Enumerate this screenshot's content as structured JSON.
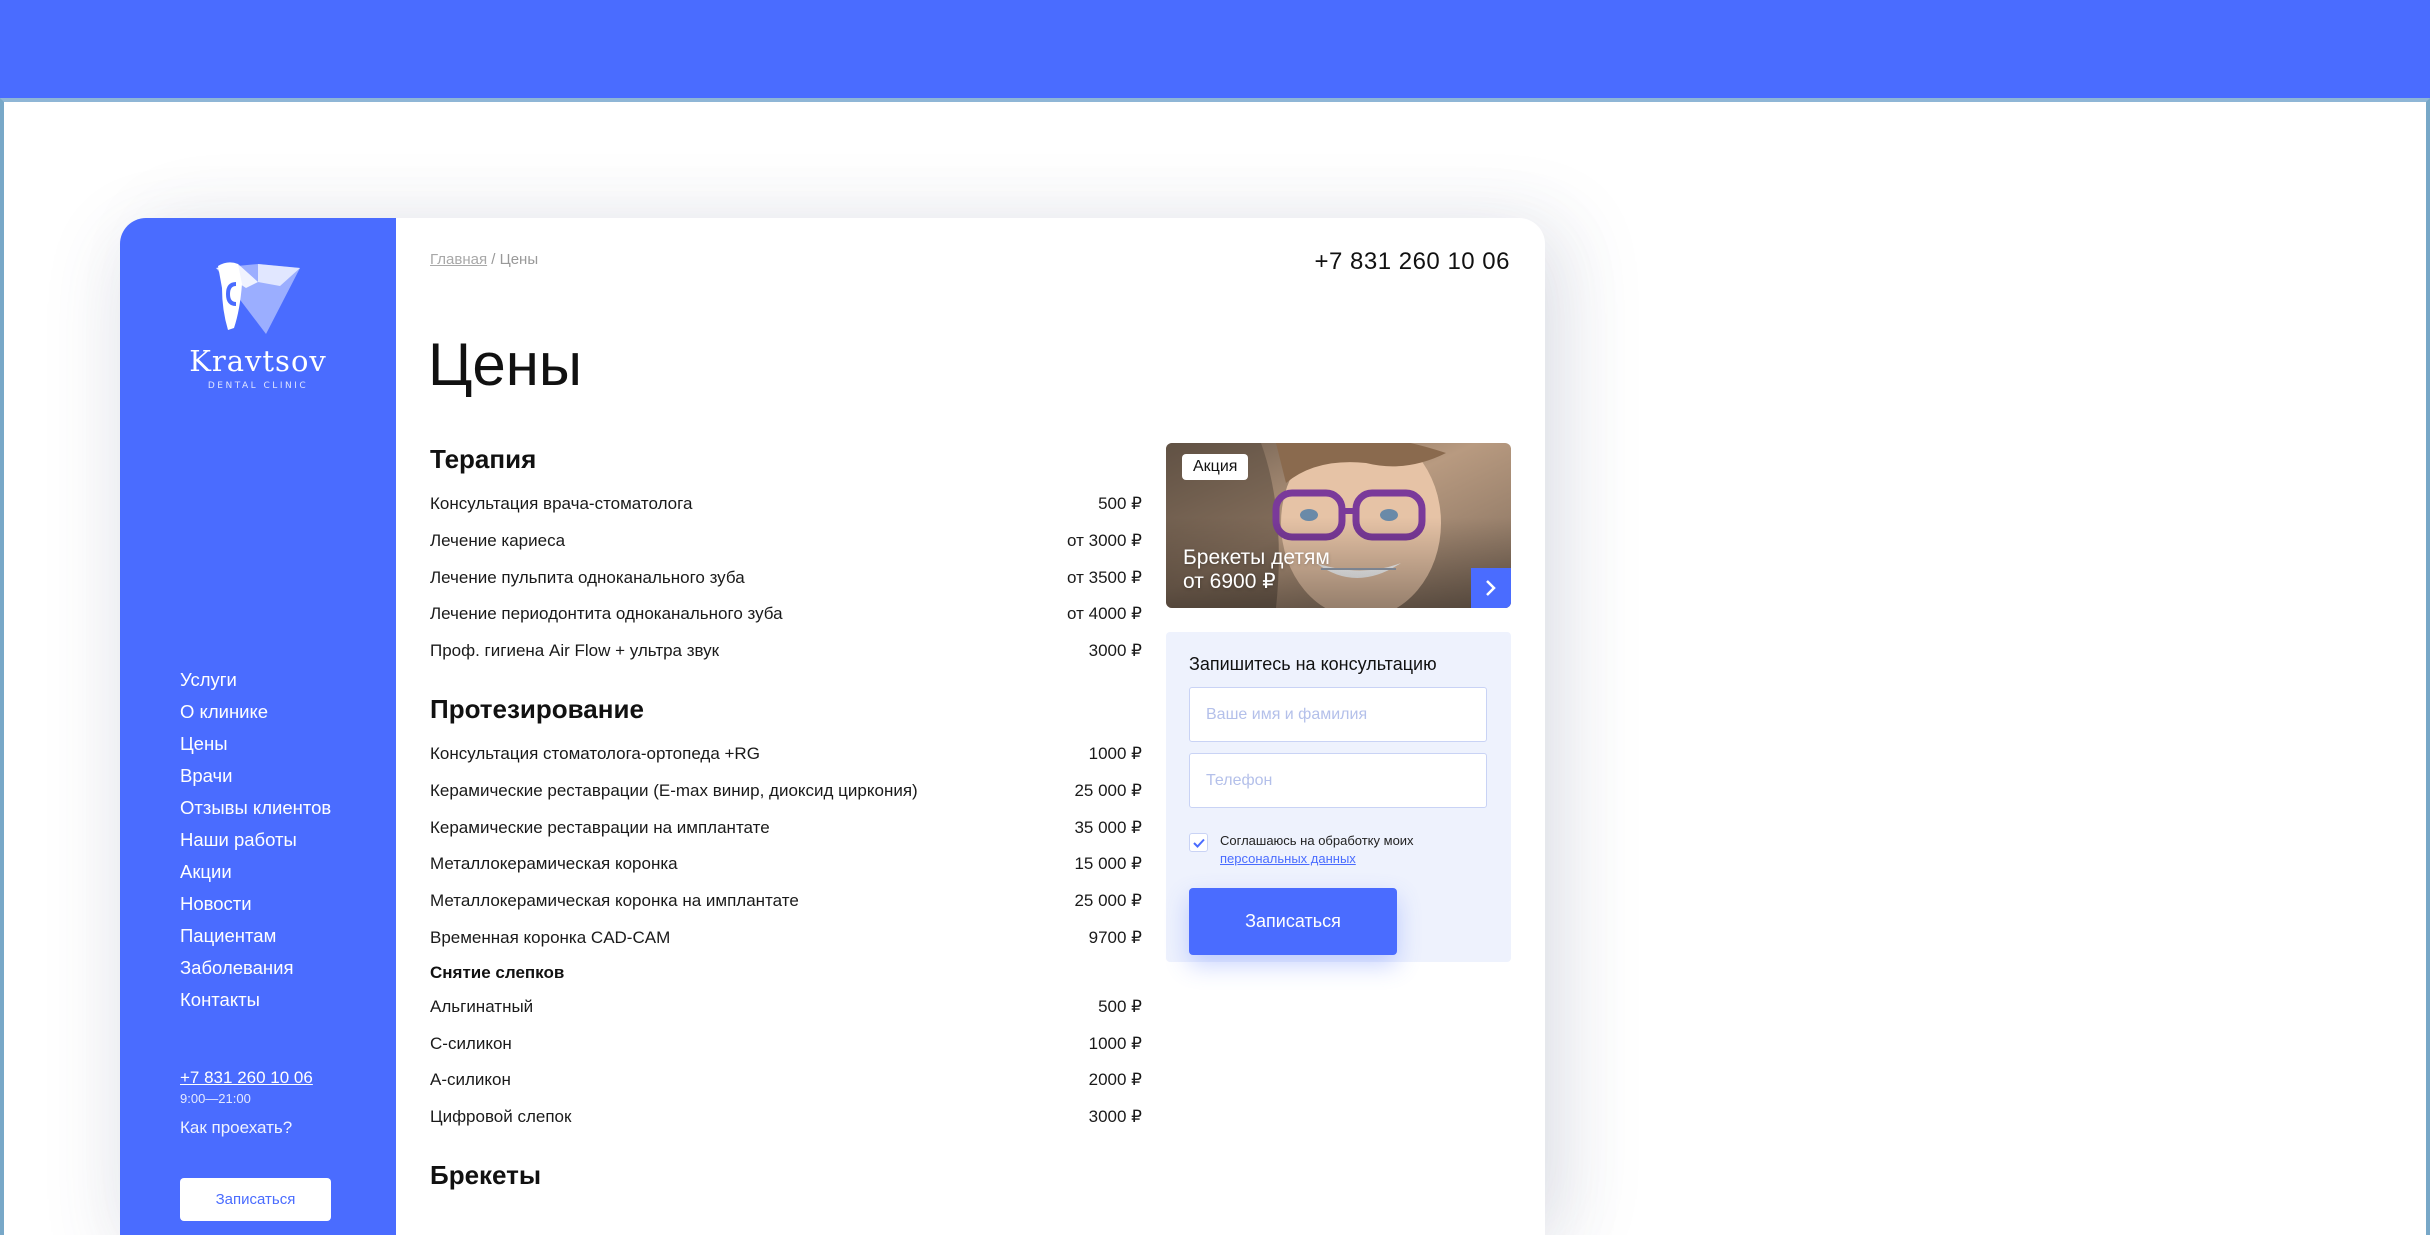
{
  "brand": {
    "name": "Kravtsov",
    "tagline": "DENTAL CLINIC",
    "accent_color": "#4a6cff"
  },
  "sidebar": {
    "nav": [
      "Услуги",
      "О клинике",
      "Цены",
      "Врачи",
      "Отзывы клиентов",
      "Наши работы",
      "Акции",
      "Новости",
      "Пациентам",
      "Заболевания",
      "Контакты"
    ],
    "phone": "+7 831 260 10 06",
    "hours": "9:00—21:00",
    "route": "Как проехать?",
    "button": "Записаться",
    "socials": [
      "vk-icon",
      "instagram-icon"
    ]
  },
  "header": {
    "breadcrumb_home": "Главная",
    "breadcrumb_sep": " / ",
    "breadcrumb_current": "Цены",
    "phone": "+7 831 260 10 06"
  },
  "page": {
    "title": "Цены"
  },
  "sections": [
    {
      "title": "Терапия",
      "rows": [
        [
          "Консультация врача-стоматолога",
          "500 ₽"
        ],
        [
          "Лечение кариеса",
          "от 3000 ₽"
        ],
        [
          "Лечение пульпита одноканального зуба",
          "от 3500 ₽"
        ],
        [
          "Лечение периодонтита одноканального зуба",
          "от 4000 ₽"
        ],
        [
          "Проф. гигиена Air Flow + ультра звук",
          "3000 ₽"
        ]
      ]
    },
    {
      "title": "Протезирование",
      "rows": [
        [
          "Консультация стоматолога-ортопеда +RG",
          "1000 ₽"
        ],
        [
          "Керамические реставрации (E-max винир, диоксид циркония)",
          "25 000 ₽"
        ],
        [
          "Керамические реставрации на имплантате",
          "35 000 ₽"
        ],
        [
          "Металлокерамическая коронка",
          "15 000 ₽"
        ],
        [
          "Металлокерамическая коронка на имплантате",
          "25 000 ₽"
        ],
        [
          "Временная коронка CAD-CAM",
          "9700 ₽"
        ]
      ],
      "subsection": {
        "title": "Снятие слепков",
        "rows": [
          [
            "Альгинатный",
            "500 ₽"
          ],
          [
            "С-силикон",
            "1000 ₽"
          ],
          [
            "А-силикон",
            "2000 ₽"
          ],
          [
            "Цифровой слепок",
            "3000 ₽"
          ]
        ]
      }
    },
    {
      "title": "Брекеты",
      "rows": []
    }
  ],
  "promo": {
    "badge": "Акция",
    "line1": "Брекеты детям",
    "line2": "от 6900 ₽"
  },
  "form": {
    "title": "Запишитесь на консультацию",
    "name_placeholder": "Ваше имя и фамилия",
    "phone_placeholder": "Телефон",
    "consent_text": "Соглашаюсь на обработку моих",
    "consent_link": "персональных данных",
    "consent_checked": true,
    "submit": "Записаться"
  }
}
